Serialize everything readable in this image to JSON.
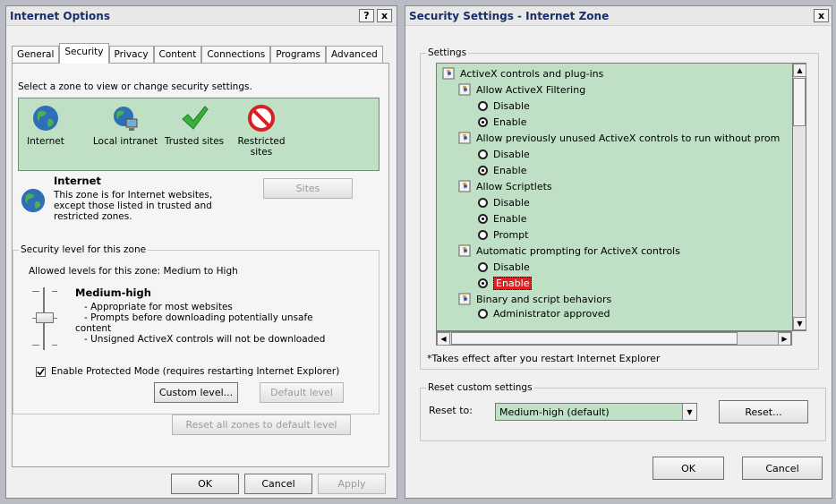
{
  "internet_options": {
    "title": "Internet Options",
    "title_help": "?",
    "title_close": "x",
    "tabs": [
      "General",
      "Security",
      "Privacy",
      "Content",
      "Connections",
      "Programs",
      "Advanced"
    ],
    "active_tab": "Security",
    "zone_prompt": "Select a zone to view or change security settings.",
    "zones": [
      {
        "label": "Internet",
        "icon": "globe-icon"
      },
      {
        "label": "Local intranet",
        "icon": "local-intranet-icon"
      },
      {
        "label": "Trusted sites",
        "icon": "checkmark-icon"
      },
      {
        "label": "Restricted sites",
        "icon": "restricted-icon"
      }
    ],
    "zone_info": {
      "name": "Internet",
      "line1": "This zone is for Internet websites,",
      "line2": "except those listed in trusted and",
      "line3": "restricted zones."
    },
    "sites_button": "Sites",
    "security_level": {
      "legend": "Security level for this zone",
      "allowed": "Allowed levels for this zone: Medium to High",
      "level_name": "Medium-high",
      "bullet1": "- Appropriate for most websites",
      "bullet2": "- Prompts before downloading potentially unsafe",
      "bullet2b": "content",
      "bullet3": "- Unsigned ActiveX controls will not be downloaded",
      "protected_mode_label": "Enable Protected Mode (requires restarting Internet Explorer)",
      "protected_mode_checked": true,
      "custom_level": "Custom level...",
      "default_level": "Default level"
    },
    "reset_all": "Reset all zones to default level",
    "ok": "OK",
    "cancel": "Cancel",
    "apply": "Apply"
  },
  "security_settings": {
    "title": "Security Settings - Internet Zone",
    "title_close": "x",
    "settings_legend": "Settings",
    "tree": [
      {
        "type": "category",
        "label": "ActiveX controls and plug-ins"
      },
      {
        "type": "setting",
        "label": "Allow ActiveX Filtering"
      },
      {
        "type": "option",
        "label": "Disable",
        "checked": false
      },
      {
        "type": "option",
        "label": "Enable",
        "checked": true
      },
      {
        "type": "setting",
        "label": "Allow previously unused ActiveX controls to run without prom"
      },
      {
        "type": "option",
        "label": "Disable",
        "checked": false
      },
      {
        "type": "option",
        "label": "Enable",
        "checked": true
      },
      {
        "type": "setting",
        "label": "Allow Scriptlets"
      },
      {
        "type": "option",
        "label": "Disable",
        "checked": false
      },
      {
        "type": "option",
        "label": "Enable",
        "checked": true
      },
      {
        "type": "option",
        "label": "Prompt",
        "checked": false
      },
      {
        "type": "setting",
        "label": "Automatic prompting for ActiveX controls"
      },
      {
        "type": "option",
        "label": "Disable",
        "checked": false
      },
      {
        "type": "option",
        "label": "Enable",
        "checked": true,
        "highlighted": true
      },
      {
        "type": "setting",
        "label": "Binary and script behaviors"
      },
      {
        "type": "option",
        "label": "Administrator approved",
        "checked": false
      }
    ],
    "note": "*Takes effect after you restart Internet Explorer",
    "reset_legend": "Reset custom settings",
    "reset_to_label": "Reset to:",
    "reset_to_value": "Medium-high (default)",
    "reset_button": "Reset...",
    "ok": "OK",
    "cancel": "Cancel"
  },
  "colors": {
    "zone_background": "#bfe0c4",
    "title_text": "#1a2d6b",
    "highlight": "#dd2222"
  }
}
